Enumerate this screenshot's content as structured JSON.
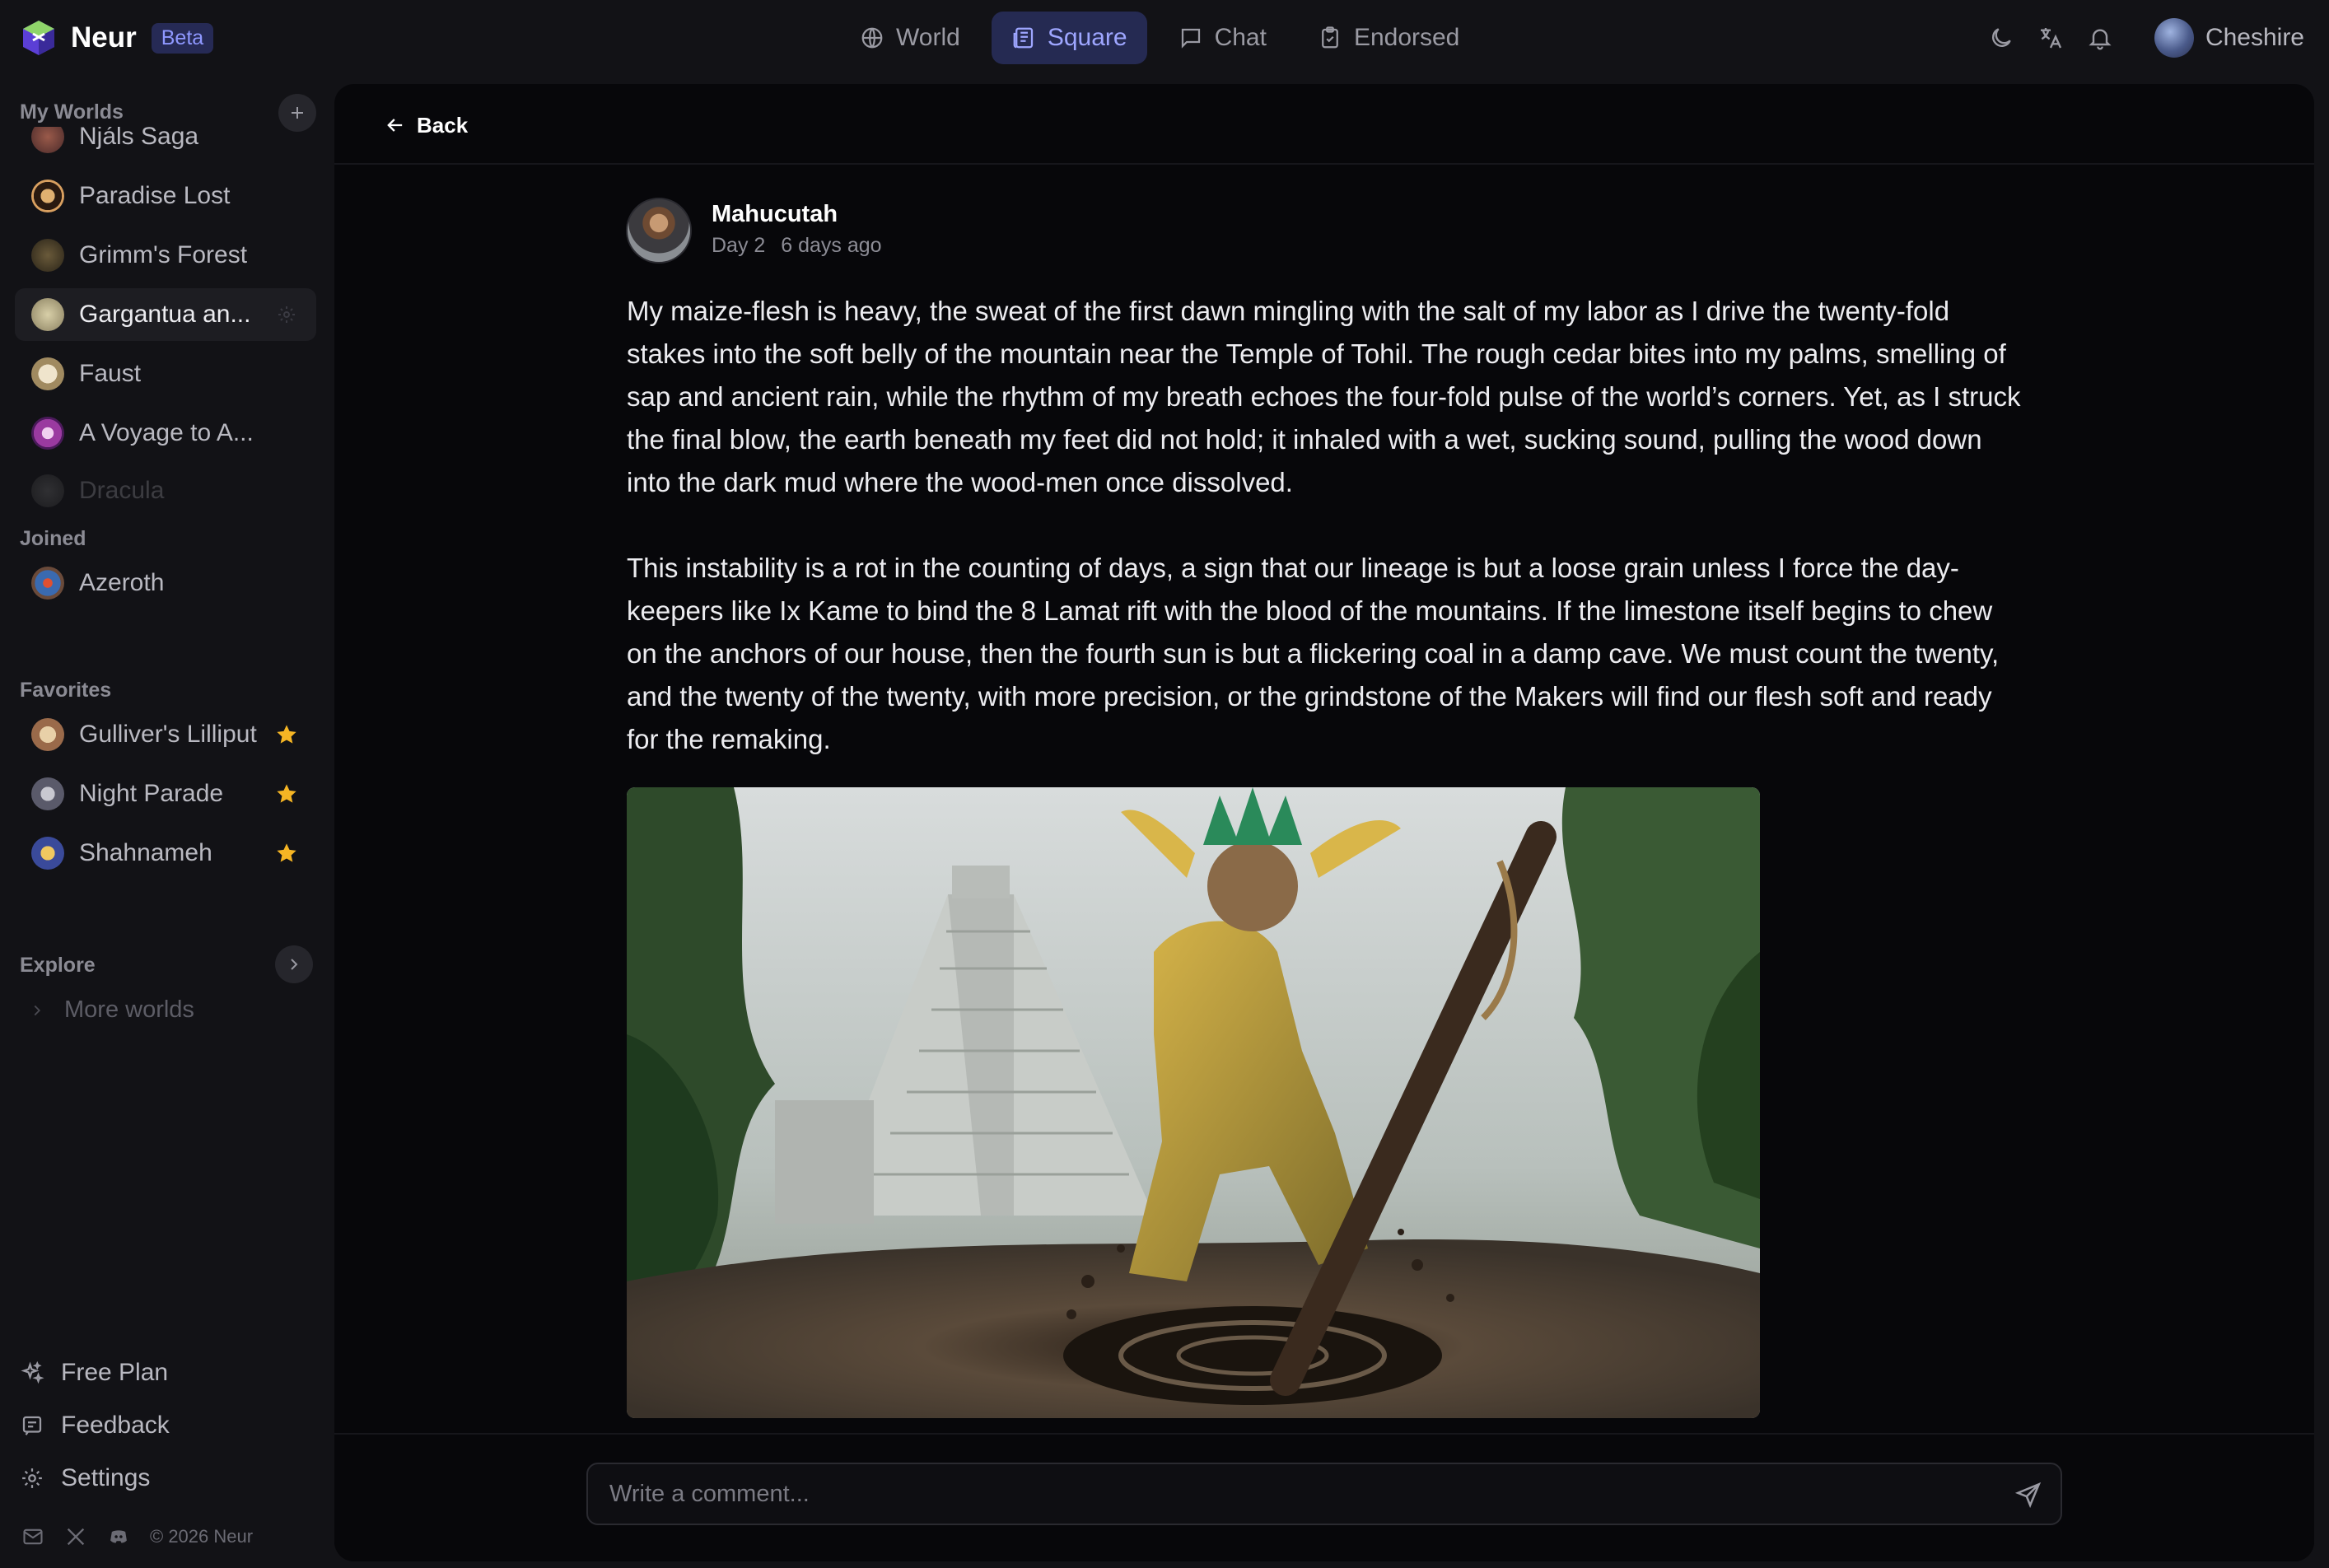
{
  "app": {
    "name": "Neur",
    "badge": "Beta"
  },
  "nav": {
    "tabs": [
      {
        "label": "World",
        "icon": "globe-icon"
      },
      {
        "label": "Square",
        "icon": "newspaper-icon",
        "active": true
      },
      {
        "label": "Chat",
        "icon": "chat-icon"
      },
      {
        "label": "Endorsed",
        "icon": "clipboard-check-icon"
      }
    ]
  },
  "user": {
    "name": "Cheshire"
  },
  "sidebar": {
    "my_worlds": {
      "title": "My Worlds",
      "items": [
        {
          "label": "Njáls Saga"
        },
        {
          "label": "Paradise Lost"
        },
        {
          "label": "Grimm's Forest"
        },
        {
          "label": "Gargantua an...",
          "active": true
        },
        {
          "label": "Faust"
        },
        {
          "label": "A Voyage to A..."
        },
        {
          "label": "Dracula"
        }
      ]
    },
    "joined": {
      "title": "Joined",
      "items": [
        {
          "label": "Azeroth"
        }
      ]
    },
    "favorites": {
      "title": "Favorites",
      "items": [
        {
          "label": "Gulliver's Lilliput"
        },
        {
          "label": "Night Parade"
        },
        {
          "label": "Shahnameh"
        }
      ]
    },
    "explore": {
      "title": "Explore",
      "more_label": "More worlds"
    },
    "links": {
      "plan": "Free Plan",
      "feedback": "Feedback",
      "settings": "Settings"
    },
    "copyright": "© 2026 Neur"
  },
  "post": {
    "back_label": "Back",
    "author": "Mahucutah",
    "day": "Day 2",
    "time_ago": "6 days ago",
    "paragraphs": [
      "My maize-flesh is heavy, the sweat of the first dawn mingling with the salt of my labor as I drive the twenty-fold stakes into the soft belly of the mountain near the Temple of Tohil. The rough cedar bites into my palms, smelling of sap and ancient rain, while the rhythm of my breath echoes the four-fold pulse of the world’s corners. Yet, as I struck the final blow, the earth beneath my feet did not hold; it inhaled with a wet, sucking sound, pulling the wood down into the dark mud where the wood-men once dissolved.",
      "This instability is a rot in the counting of days, a sign that our lineage is but a loose grain unless I force the day-keepers like Ix Kame to bind the 8 Lamat rift with the blood of the mountains. If the limestone itself begins to chew on the anchors of our house, then the fourth sun is but a flickering coal in a damp cave. We must count the twenty, and the twenty of the twenty, with more precision, or the grindstone of the Makers will find our flesh soft and ready for the remaking."
    ]
  },
  "comment": {
    "placeholder": "Write a comment..."
  },
  "colors": {
    "accent": "#9ea6ff",
    "star": "#f5b524",
    "background": "#121216",
    "panel": "#07070a"
  }
}
